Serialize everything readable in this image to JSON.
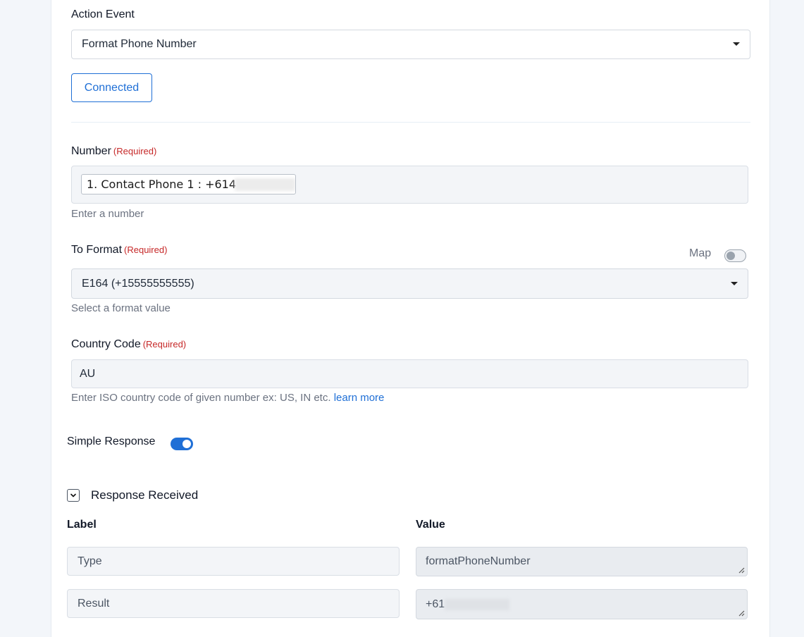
{
  "action_event": {
    "label": "Action Event",
    "selected": "Format Phone Number"
  },
  "connected_button": "Connected",
  "number": {
    "label": "Number",
    "required": "(Required)",
    "chip_text": "1. Contact Phone 1 : +614",
    "help": "Enter a number"
  },
  "to_format": {
    "label": "To Format",
    "required": "(Required)",
    "map_label": "Map",
    "selected": "E164 (+15555555555)",
    "help": "Select a format value"
  },
  "country_code": {
    "label": "Country Code",
    "required": "(Required)",
    "value": "AU",
    "help": "Enter ISO country code of given number ex: US, IN etc.",
    "learn_more": "learn more"
  },
  "simple_response": {
    "label": "Simple Response",
    "enabled": true
  },
  "response_received": {
    "title": "Response Received",
    "col_label": "Label",
    "col_value": "Value",
    "rows": [
      {
        "label": "Type",
        "value": "formatPhoneNumber"
      },
      {
        "label": "Result",
        "value": "+61"
      }
    ]
  },
  "colors": {
    "accent": "#1f6fd6",
    "required": "#c62828",
    "background": "#f3f6fa"
  }
}
